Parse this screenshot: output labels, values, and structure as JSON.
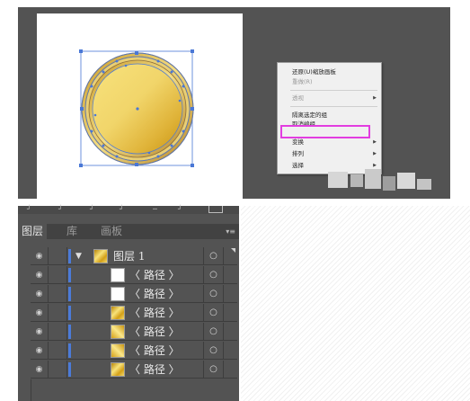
{
  "context_menu": {
    "items": [
      {
        "label": "还原(U)缩放画板",
        "disabled": false,
        "submenu": false
      },
      {
        "label": "重做(R)",
        "disabled": true,
        "submenu": false
      },
      {
        "label": "透视",
        "disabled": true,
        "submenu": true
      },
      {
        "label": "隔离选定的组",
        "disabled": false,
        "submenu": false
      },
      {
        "label": "取消编组",
        "disabled": false,
        "submenu": false,
        "highlighted": true
      },
      {
        "label": "变换",
        "disabled": false,
        "submenu": true
      },
      {
        "label": "排列",
        "disabled": false,
        "submenu": true
      },
      {
        "label": "选择",
        "disabled": false,
        "submenu": true
      }
    ],
    "highlight_color": "#e23de0"
  },
  "panel": {
    "tabs": [
      {
        "label": "图层",
        "active": true
      },
      {
        "label": "库",
        "active": false
      },
      {
        "label": "画板",
        "active": false
      }
    ],
    "layers": [
      {
        "name": "图层 1",
        "kind": "layer",
        "thumb": "gold"
      },
      {
        "name": "〈 路径 〉",
        "kind": "path",
        "thumb": "white"
      },
      {
        "name": "〈 路径 〉",
        "kind": "path",
        "thumb": "white"
      },
      {
        "name": "〈 路径 〉",
        "kind": "path",
        "thumb": "gold"
      },
      {
        "name": "〈 路径 〉",
        "kind": "path",
        "thumb": "gold2"
      },
      {
        "name": "〈 路径 〉",
        "kind": "path",
        "thumb": "gold2"
      },
      {
        "name": "〈 路径 〉",
        "kind": "path",
        "thumb": "gold"
      }
    ],
    "layer_color": "#4b7bd9",
    "eye_icon": "eye-icon",
    "target_icon": "target-circle-icon"
  },
  "colors": {
    "canvas_bg": "#535353",
    "selection_blue": "#4a78d6",
    "gold_light": "#f7e27a",
    "gold_dark": "#c99410"
  }
}
